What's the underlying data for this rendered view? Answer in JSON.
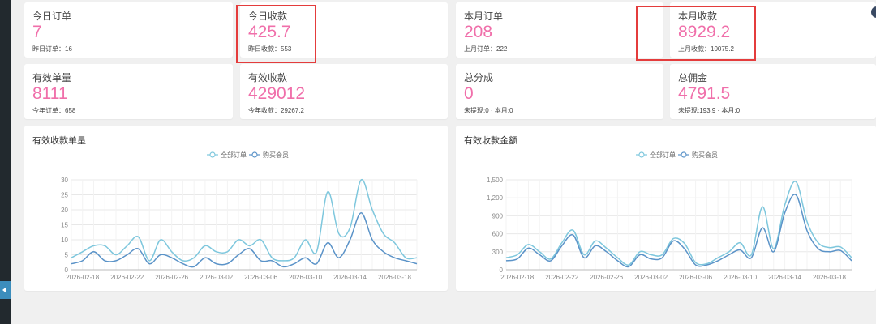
{
  "stats": [
    {
      "label": "今日订单",
      "value": "7",
      "sub": "昨日订单：16"
    },
    {
      "label": "今日收款",
      "value": "425.7",
      "sub": "昨日收款：553"
    },
    {
      "label": "本月订单",
      "value": "208",
      "sub": "上月订单：222"
    },
    {
      "label": "本月收款",
      "value": "8929.2",
      "sub": "上月收款：10075.2"
    },
    {
      "label": "有效单量",
      "value": "8111",
      "sub": "今年订单：658"
    },
    {
      "label": "有效收款",
      "value": "429012",
      "sub": "今年收款：29267.2"
    },
    {
      "label": "总分成",
      "value": "0",
      "sub": "未提现:0 · 本月:0"
    },
    {
      "label": "总佣金",
      "value": "4791.5",
      "sub": "未提现:193.9 · 本月:0"
    }
  ],
  "colors": {
    "value": "#f06faa",
    "series_all": "#7ec7dd",
    "series_member": "#5b93c8",
    "highlight": "#e43c3c"
  },
  "chart_data": [
    {
      "type": "line",
      "title": "有效收款单量",
      "x": [
        "2026-02-17",
        "2026-02-18",
        "2026-02-19",
        "2026-02-20",
        "2026-02-21",
        "2026-02-22",
        "2026-02-23",
        "2026-02-24",
        "2026-02-25",
        "2026-02-26",
        "2026-02-27",
        "2026-02-28",
        "2026-03-01",
        "2026-03-02",
        "2026-03-03",
        "2026-03-04",
        "2026-03-05",
        "2026-03-06",
        "2026-03-07",
        "2026-03-08",
        "2026-03-09",
        "2026-03-10",
        "2026-03-11",
        "2026-03-12",
        "2026-03-13",
        "2026-03-14",
        "2026-03-15",
        "2026-03-16",
        "2026-03-17",
        "2026-03-18",
        "2026-03-19",
        "2026-03-20"
      ],
      "x_ticks": [
        "2026-02-18",
        "2026-02-22",
        "2026-02-26",
        "2026-03-02",
        "2026-03-06",
        "2026-03-10",
        "2026-03-14",
        "2026-03-18"
      ],
      "ylim": [
        0,
        30
      ],
      "y_ticks": [
        0,
        5,
        10,
        15,
        20,
        25,
        30
      ],
      "y_tick_labels": [
        "0",
        "5",
        "10",
        "15",
        "20",
        "25",
        "30"
      ],
      "legend": "top-center",
      "series": [
        {
          "name": "全部订单",
          "values": [
            4,
            6,
            8,
            8,
            5,
            8,
            11,
            3,
            10,
            6,
            3,
            4,
            8,
            6,
            6,
            10,
            8,
            10,
            4,
            3,
            4,
            10,
            6,
            26,
            12,
            14,
            30,
            20,
            12,
            9,
            4,
            4
          ]
        },
        {
          "name": "购买会员",
          "values": [
            2,
            3,
            6,
            3,
            3,
            5,
            7,
            2,
            5,
            4,
            2,
            1,
            4,
            2,
            2,
            5,
            7,
            3,
            3,
            1,
            2,
            4,
            2,
            9,
            4,
            10,
            19,
            10,
            6,
            4,
            3,
            2
          ]
        }
      ]
    },
    {
      "type": "line",
      "title": "有效收款金额",
      "x": [
        "2026-02-17",
        "2026-02-18",
        "2026-02-19",
        "2026-02-20",
        "2026-02-21",
        "2026-02-22",
        "2026-02-23",
        "2026-02-24",
        "2026-02-25",
        "2026-02-26",
        "2026-02-27",
        "2026-02-28",
        "2026-03-01",
        "2026-03-02",
        "2026-03-03",
        "2026-03-04",
        "2026-03-05",
        "2026-03-06",
        "2026-03-07",
        "2026-03-08",
        "2026-03-09",
        "2026-03-10",
        "2026-03-11",
        "2026-03-12",
        "2026-03-13",
        "2026-03-14",
        "2026-03-15",
        "2026-03-16",
        "2026-03-17",
        "2026-03-18",
        "2026-03-19",
        "2026-03-20"
      ],
      "x_ticks": [
        "2026-02-18",
        "2026-02-22",
        "2026-02-26",
        "2026-03-02",
        "2026-03-06",
        "2026-03-10",
        "2026-03-14",
        "2026-03-18"
      ],
      "ylim": [
        0,
        1500
      ],
      "y_ticks": [
        0,
        300,
        600,
        900,
        1200,
        1500
      ],
      "y_tick_labels": [
        "0",
        "300",
        "600",
        "900",
        "1,200",
        "1,500"
      ],
      "legend": "top-center",
      "series": [
        {
          "name": "全部订单",
          "values": [
            200,
            250,
            420,
            300,
            180,
            450,
            660,
            250,
            480,
            360,
            200,
            80,
            300,
            250,
            250,
            520,
            440,
            120,
            100,
            200,
            300,
            450,
            250,
            1050,
            350,
            1080,
            1470,
            800,
            450,
            370,
            380,
            200
          ]
        },
        {
          "name": "购买会员",
          "values": [
            150,
            180,
            360,
            250,
            150,
            400,
            580,
            200,
            400,
            300,
            150,
            50,
            250,
            180,
            200,
            480,
            350,
            80,
            80,
            150,
            250,
            330,
            200,
            700,
            300,
            950,
            1250,
            650,
            350,
            300,
            320,
            150
          ]
        }
      ]
    }
  ]
}
